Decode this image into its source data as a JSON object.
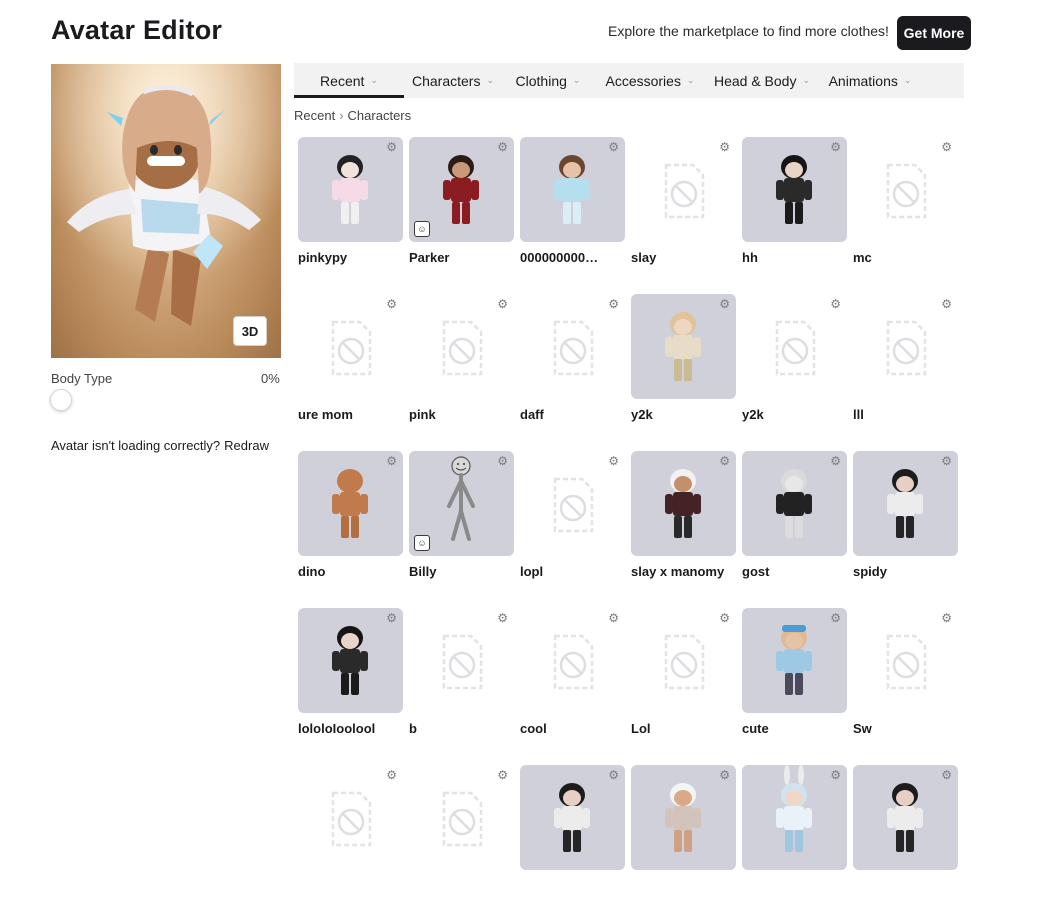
{
  "page": {
    "title": "Avatar Editor",
    "marketplace_message": "Explore the marketplace to find more clothes!",
    "get_more_label": "Get More"
  },
  "preview": {
    "view_mode_label": "3D",
    "body_type_label": "Body Type",
    "body_type_value": "0%",
    "body_type_percent": 0,
    "loading_message": "Avatar isn't loading correctly?",
    "redraw_label": "Redraw"
  },
  "tabs": [
    {
      "label": "Recent",
      "active": true
    },
    {
      "label": "Characters",
      "active": false
    },
    {
      "label": "Clothing",
      "active": false
    },
    {
      "label": "Accessories",
      "active": false
    },
    {
      "label": "Head & Body",
      "active": false
    },
    {
      "label": "Animations",
      "active": false
    }
  ],
  "breadcrumb": [
    "Recent",
    "Characters"
  ],
  "characters": [
    {
      "name": "pinkypy",
      "image": "avatar-pink-cat",
      "badge": false
    },
    {
      "name": "Parker",
      "image": "avatar-red-outfit",
      "badge": true
    },
    {
      "name": "000000000…",
      "image": "avatar-blue-twins",
      "badge": false
    },
    {
      "name": "slay",
      "image": "placeholder",
      "badge": false
    },
    {
      "name": "hh",
      "image": "avatar-black-pigtails",
      "badge": false
    },
    {
      "name": "mc",
      "image": "placeholder",
      "badge": false
    },
    {
      "name": "ure mom",
      "image": "placeholder",
      "badge": false
    },
    {
      "name": "pink",
      "image": "placeholder",
      "badge": false
    },
    {
      "name": "daff",
      "image": "placeholder",
      "badge": false
    },
    {
      "name": "y2k",
      "image": "avatar-long-blonde",
      "badge": false
    },
    {
      "name": "y2k",
      "image": "placeholder",
      "badge": false
    },
    {
      "name": "lll",
      "image": "placeholder",
      "badge": false
    },
    {
      "name": "dino",
      "image": "avatar-bacon-classic",
      "badge": false
    },
    {
      "name": "Billy",
      "image": "avatar-stick-smiley",
      "badge": true
    },
    {
      "name": "lopl",
      "image": "placeholder",
      "badge": false
    },
    {
      "name": "slay x manomy",
      "image": "avatar-panda-hat",
      "badge": false
    },
    {
      "name": "gost",
      "image": "avatar-grey-ghost",
      "badge": false
    },
    {
      "name": "spidy",
      "image": "avatar-dark-hair",
      "badge": false
    },
    {
      "name": "lololoIoolool",
      "image": "avatar-black-pigtails",
      "badge": false
    },
    {
      "name": "b",
      "image": "placeholder",
      "badge": false
    },
    {
      "name": "cool",
      "image": "placeholder",
      "badge": false
    },
    {
      "name": "Lol",
      "image": "placeholder",
      "badge": false
    },
    {
      "name": "cute",
      "image": "avatar-blue-cap",
      "badge": false
    },
    {
      "name": "Sw",
      "image": "placeholder",
      "badge": false
    },
    {
      "name": "",
      "image": "placeholder",
      "badge": false
    },
    {
      "name": "",
      "image": "placeholder",
      "badge": false
    },
    {
      "name": "",
      "image": "avatar-dark-hair",
      "badge": false
    },
    {
      "name": "",
      "image": "avatar-white-hat",
      "badge": false
    },
    {
      "name": "",
      "image": "avatar-bunny-ears",
      "badge": false
    },
    {
      "name": "",
      "image": "avatar-dark-hair",
      "badge": false
    }
  ],
  "icons": {
    "gear": "gear-icon",
    "placeholder": "no-image-icon",
    "emote": "emote-badge-icon",
    "chevron": "chevron-down-icon"
  }
}
